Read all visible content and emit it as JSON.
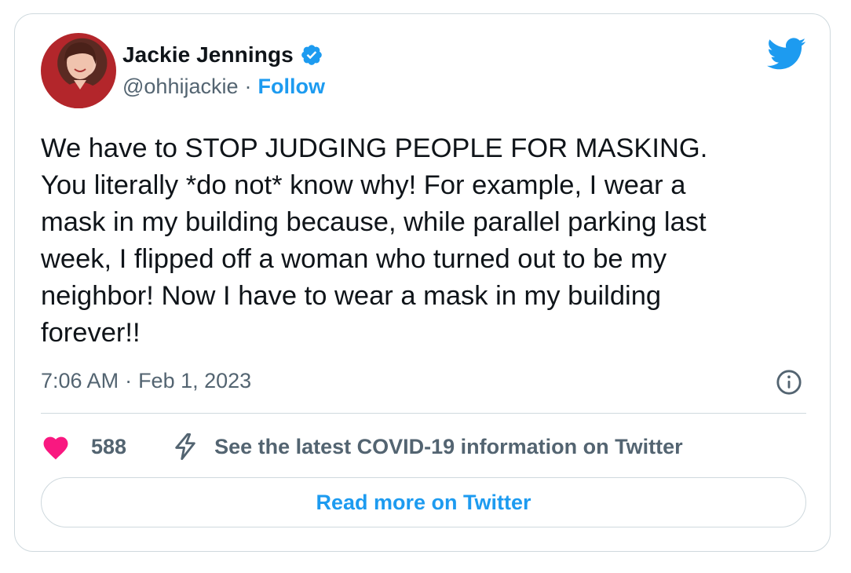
{
  "author": {
    "name": "Jackie Jennings",
    "handle": "@ohhijackie",
    "separator": "·",
    "follow_label": "Follow",
    "verified": true
  },
  "icons": {
    "verified": "verified-badge-icon",
    "brand": "twitter-bird-icon",
    "info": "info-icon",
    "like": "heart-icon",
    "covid": "lightning-bolt-icon"
  },
  "tweet": {
    "text": "We have to STOP JUDGING PEOPLE FOR MASKING.\nYou literally *do not* know why! For example, I wear a\nmask in my building because, while parallel parking last\nweek, I flipped off a woman who turned out to be my\nneighbor! Now I have to wear a mask in my building\nforever!!",
    "time": "7:06 AM",
    "meta_separator": "·",
    "date": "Feb 1, 2023"
  },
  "actions": {
    "likes": "588",
    "covid_label": "See the latest COVID-19 information on Twitter",
    "read_more_label": "Read more on Twitter"
  },
  "colors": {
    "brand_blue": "#1d9bf0",
    "like_pink": "#f91880",
    "secondary_text": "#536471",
    "border": "#cfd9de"
  }
}
